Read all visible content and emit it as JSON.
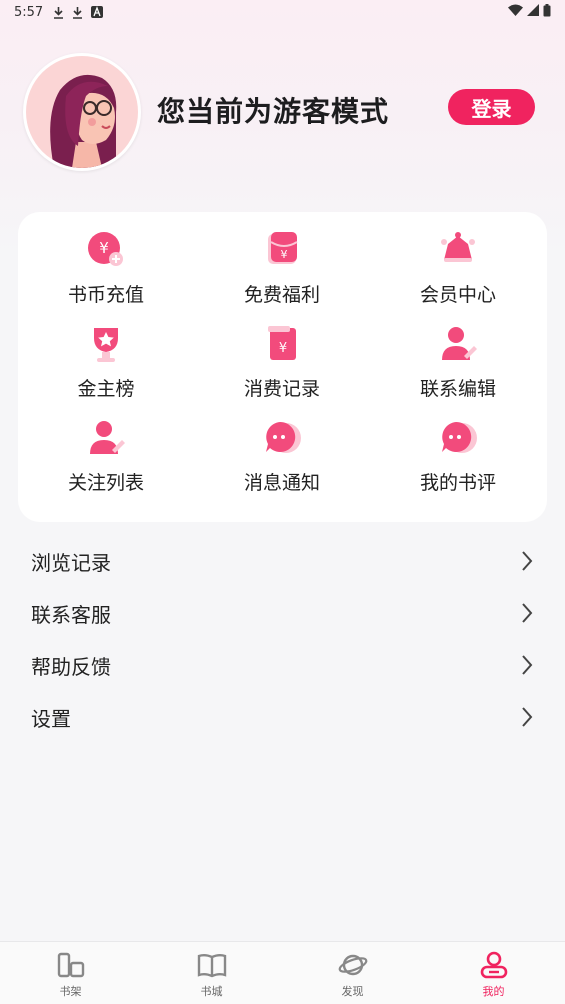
{
  "status_bar": {
    "time": "5:57",
    "notification_icons": [
      "download-icon",
      "download-icon",
      "font-a-icon"
    ],
    "system_icons": [
      "wifi-icon",
      "signal-icon",
      "battery-icon"
    ]
  },
  "header": {
    "avatar_icon": "user-avatar-illustration",
    "title": "您当前为游客模式",
    "login_label": "登录"
  },
  "grid": {
    "items": [
      {
        "label": "书币充值",
        "icon": "coin-recharge-icon"
      },
      {
        "label": "免费福利",
        "icon": "red-envelope-icon"
      },
      {
        "label": "会员中心",
        "icon": "crown-icon"
      },
      {
        "label": "金主榜",
        "icon": "trophy-icon"
      },
      {
        "label": "消费记录",
        "icon": "bill-icon"
      },
      {
        "label": "联系编辑",
        "icon": "contact-editor-icon"
      },
      {
        "label": "关注列表",
        "icon": "follow-list-icon"
      },
      {
        "label": "消息通知",
        "icon": "message-icon"
      },
      {
        "label": "我的书评",
        "icon": "comment-icon"
      }
    ]
  },
  "menu": {
    "items": [
      {
        "label": "浏览记录",
        "icon": "chevron-right-icon"
      },
      {
        "label": "联系客服",
        "icon": "chevron-right-icon"
      },
      {
        "label": "帮助反馈",
        "icon": "chevron-right-icon"
      },
      {
        "label": "设置",
        "icon": "chevron-right-icon"
      }
    ]
  },
  "tabs": [
    {
      "label": "书架",
      "icon": "bookshelf-icon",
      "active": false
    },
    {
      "label": "书城",
      "icon": "open-book-icon",
      "active": false
    },
    {
      "label": "发现",
      "icon": "planet-icon",
      "active": false
    },
    {
      "label": "我的",
      "icon": "profile-icon",
      "active": true
    }
  ],
  "colors": {
    "accent": "#f0235f",
    "icon_pink": "#f24b7c",
    "icon_light_pink": "#fbc6d4",
    "background": "#f6f6f8",
    "card": "#ffffff",
    "text": "#222222",
    "tab_inactive": "#888888"
  }
}
